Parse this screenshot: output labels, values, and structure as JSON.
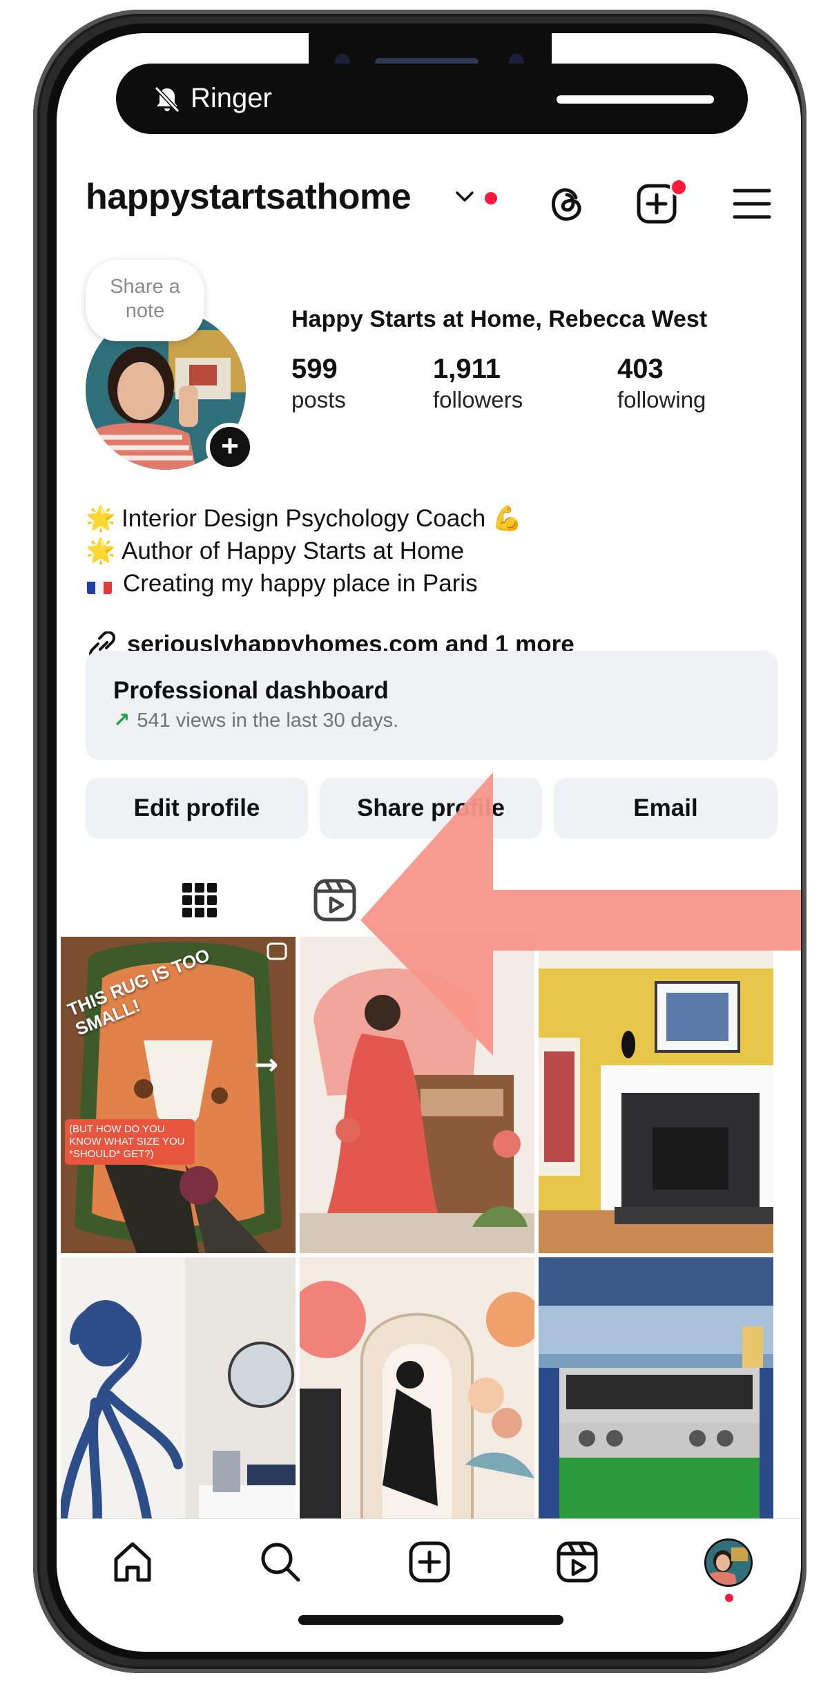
{
  "status": {
    "ringer_label": "Ringer"
  },
  "header": {
    "username": "happystartsathome"
  },
  "profile": {
    "note_text": "Share a note",
    "full_name": "Happy Starts at Home, Rebecca West",
    "stats": [
      {
        "value": "599",
        "label": "posts"
      },
      {
        "value": "1,911",
        "label": "followers"
      },
      {
        "value": "403",
        "label": "following"
      }
    ],
    "bio": [
      {
        "emoji": "🌟",
        "text": "Interior Design Psychology Coach 💪"
      },
      {
        "emoji": "🌟",
        "text": "Author of Happy Starts at Home"
      },
      {
        "emoji": "flag-fr",
        "text": "Creating my happy place in Paris"
      }
    ],
    "link_text": "seriouslyhappyhomes.com and 1 more"
  },
  "dashboard": {
    "title": "Professional dashboard",
    "subtitle": "541 views in the last 30 days.",
    "trend_icon": "↗"
  },
  "actions": {
    "edit": "Edit profile",
    "share": "Share profile",
    "email": "Email"
  },
  "grid": {
    "post1_title": "THIS RUG IS TOO SMALL!",
    "post1_caption": "(BUT HOW DO YOU KNOW WHAT SIZE YOU *SHOULD* GET?)"
  },
  "annotation": {
    "arrow_color": "#f7958a"
  },
  "colors": {
    "notification_red": "#ff1a3c",
    "button_bg": "#eff1f4",
    "trend_green": "#1aa34a"
  },
  "icons": [
    "ringer-off-icon",
    "chevron-down-icon",
    "threads-icon",
    "create-icon",
    "menu-icon",
    "link-icon",
    "grid-icon",
    "reels-icon",
    "home-icon",
    "search-icon",
    "add-icon",
    "reels-nav-icon"
  ]
}
